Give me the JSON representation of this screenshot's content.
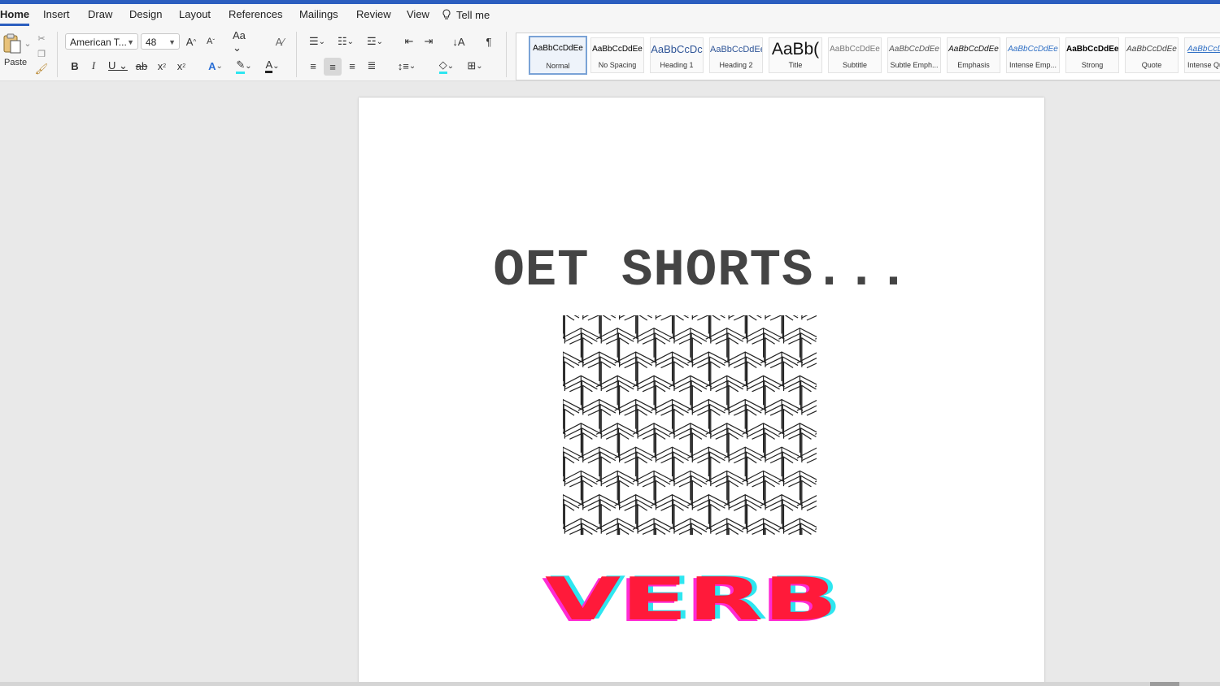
{
  "ribbon": {
    "tabs": [
      "Home",
      "Insert",
      "Draw",
      "Design",
      "Layout",
      "References",
      "Mailings",
      "Review",
      "View"
    ],
    "tell_me": "Tell me",
    "paste_label": "Paste",
    "font_name": "American T...",
    "font_size": "48",
    "styles": [
      {
        "sample": "AaBbCcDdEe",
        "name": "Normal"
      },
      {
        "sample": "AaBbCcDdEe",
        "name": "No Spacing"
      },
      {
        "sample": "AaBbCcDc",
        "name": "Heading 1"
      },
      {
        "sample": "AaBbCcDdEe",
        "name": "Heading 2"
      },
      {
        "sample": "AaBb(",
        "name": "Title"
      },
      {
        "sample": "AaBbCcDdEe",
        "name": "Subtitle"
      },
      {
        "sample": "AaBbCcDdEe",
        "name": "Subtle Emph..."
      },
      {
        "sample": "AaBbCcDdEe",
        "name": "Emphasis"
      },
      {
        "sample": "AaBbCcDdEe",
        "name": "Intense Emp..."
      },
      {
        "sample": "AaBbCcDdEe",
        "name": "Strong"
      },
      {
        "sample": "AaBbCcDdEe",
        "name": "Quote"
      },
      {
        "sample": "AaBbCcD",
        "name": "Intense Qu..."
      }
    ]
  },
  "document": {
    "title": "OET SHORTS...",
    "logo_text": "VERB"
  },
  "colors": {
    "accent": "#2b5ebf",
    "logo_red": "#ff1a3a",
    "logo_cyan": "#2ee6f0",
    "logo_magenta": "#ff2ad4"
  }
}
